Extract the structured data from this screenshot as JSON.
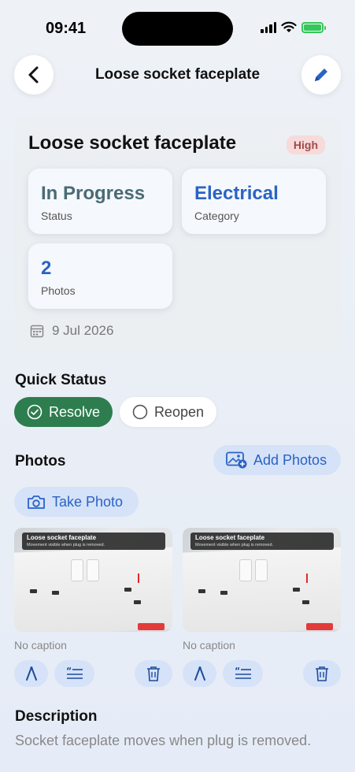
{
  "status_bar": {
    "time": "09:41"
  },
  "nav": {
    "title": "Loose socket faceplate",
    "back_icon": "chevron-left-icon",
    "edit_icon": "pencil-icon"
  },
  "summary": {
    "title": "Loose socket faceplate",
    "priority": "High",
    "tiles": [
      {
        "value": "In Progress",
        "label": "Status",
        "color": "#4a6b74"
      },
      {
        "value": "Electrical",
        "label": "Category",
        "color": "#2a63c4"
      },
      {
        "value": "2",
        "label": "Photos",
        "color": "#2a63c4"
      }
    ],
    "date": "9 Jul 2026"
  },
  "quick_status": {
    "heading": "Quick Status",
    "resolve_label": "Resolve",
    "reopen_label": "Reopen"
  },
  "photos": {
    "heading": "Photos",
    "add_label": "Add Photos",
    "take_label": "Take Photo",
    "items": [
      {
        "overlay_title": "Loose socket faceplate",
        "overlay_subtitle": "Movement visible when plug is removed.",
        "caption": "No caption"
      },
      {
        "overlay_title": "Loose socket faceplate",
        "overlay_subtitle": "Movement visible when plug is removed.",
        "caption": "No caption"
      }
    ]
  },
  "description": {
    "heading": "Description",
    "text": "Socket faceplate moves when plug is removed."
  },
  "colors": {
    "accent": "#2a63c4",
    "resolve": "#2e7d4f",
    "priority_bg": "#f7dada",
    "priority_text": "#a04a4a"
  }
}
